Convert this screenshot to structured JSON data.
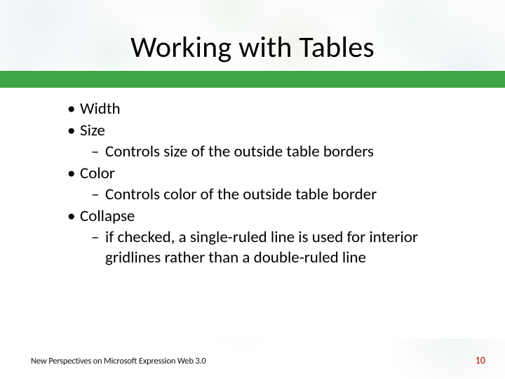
{
  "slide": {
    "title": "Working with Tables",
    "bullets": {
      "b0": {
        "label": "Width"
      },
      "b1": {
        "label": "Size",
        "sub": {
          "s0": "Controls size of the outside table borders"
        }
      },
      "b2": {
        "label": "Color",
        "sub": {
          "s0": "Controls color of the outside table border"
        }
      },
      "b3": {
        "label": "Collapse",
        "sub": {
          "s0": "if checked, a single-ruled line is used  for interior gridlines rather than a double-ruled line"
        }
      }
    }
  },
  "footer": {
    "source": "New Perspectives on Microsoft Expression Web 3.0",
    "page": "10"
  },
  "colors": {
    "accent_bar": "#3ea447",
    "page_number": "#c00000"
  }
}
